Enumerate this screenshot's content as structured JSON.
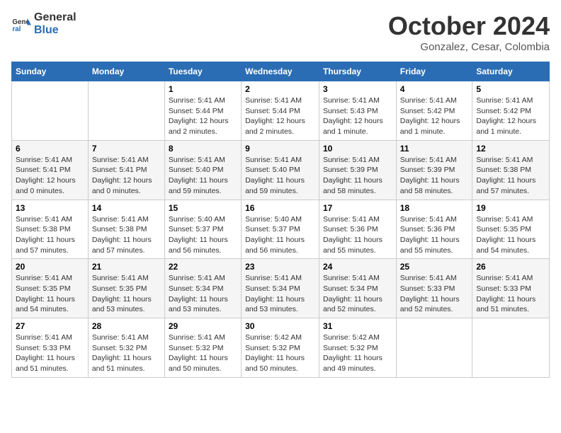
{
  "header": {
    "logo_general": "General",
    "logo_blue": "Blue",
    "month": "October 2024",
    "location": "Gonzalez, Cesar, Colombia"
  },
  "weekdays": [
    "Sunday",
    "Monday",
    "Tuesday",
    "Wednesday",
    "Thursday",
    "Friday",
    "Saturday"
  ],
  "weeks": [
    [
      {
        "day": "",
        "info": ""
      },
      {
        "day": "",
        "info": ""
      },
      {
        "day": "1",
        "info": "Sunrise: 5:41 AM\nSunset: 5:44 PM\nDaylight: 12 hours and 2 minutes."
      },
      {
        "day": "2",
        "info": "Sunrise: 5:41 AM\nSunset: 5:44 PM\nDaylight: 12 hours and 2 minutes."
      },
      {
        "day": "3",
        "info": "Sunrise: 5:41 AM\nSunset: 5:43 PM\nDaylight: 12 hours and 1 minute."
      },
      {
        "day": "4",
        "info": "Sunrise: 5:41 AM\nSunset: 5:42 PM\nDaylight: 12 hours and 1 minute."
      },
      {
        "day": "5",
        "info": "Sunrise: 5:41 AM\nSunset: 5:42 PM\nDaylight: 12 hours and 1 minute."
      }
    ],
    [
      {
        "day": "6",
        "info": "Sunrise: 5:41 AM\nSunset: 5:41 PM\nDaylight: 12 hours and 0 minutes."
      },
      {
        "day": "7",
        "info": "Sunrise: 5:41 AM\nSunset: 5:41 PM\nDaylight: 12 hours and 0 minutes."
      },
      {
        "day": "8",
        "info": "Sunrise: 5:41 AM\nSunset: 5:40 PM\nDaylight: 11 hours and 59 minutes."
      },
      {
        "day": "9",
        "info": "Sunrise: 5:41 AM\nSunset: 5:40 PM\nDaylight: 11 hours and 59 minutes."
      },
      {
        "day": "10",
        "info": "Sunrise: 5:41 AM\nSunset: 5:39 PM\nDaylight: 11 hours and 58 minutes."
      },
      {
        "day": "11",
        "info": "Sunrise: 5:41 AM\nSunset: 5:39 PM\nDaylight: 11 hours and 58 minutes."
      },
      {
        "day": "12",
        "info": "Sunrise: 5:41 AM\nSunset: 5:38 PM\nDaylight: 11 hours and 57 minutes."
      }
    ],
    [
      {
        "day": "13",
        "info": "Sunrise: 5:41 AM\nSunset: 5:38 PM\nDaylight: 11 hours and 57 minutes."
      },
      {
        "day": "14",
        "info": "Sunrise: 5:41 AM\nSunset: 5:38 PM\nDaylight: 11 hours and 57 minutes."
      },
      {
        "day": "15",
        "info": "Sunrise: 5:40 AM\nSunset: 5:37 PM\nDaylight: 11 hours and 56 minutes."
      },
      {
        "day": "16",
        "info": "Sunrise: 5:40 AM\nSunset: 5:37 PM\nDaylight: 11 hours and 56 minutes."
      },
      {
        "day": "17",
        "info": "Sunrise: 5:41 AM\nSunset: 5:36 PM\nDaylight: 11 hours and 55 minutes."
      },
      {
        "day": "18",
        "info": "Sunrise: 5:41 AM\nSunset: 5:36 PM\nDaylight: 11 hours and 55 minutes."
      },
      {
        "day": "19",
        "info": "Sunrise: 5:41 AM\nSunset: 5:35 PM\nDaylight: 11 hours and 54 minutes."
      }
    ],
    [
      {
        "day": "20",
        "info": "Sunrise: 5:41 AM\nSunset: 5:35 PM\nDaylight: 11 hours and 54 minutes."
      },
      {
        "day": "21",
        "info": "Sunrise: 5:41 AM\nSunset: 5:35 PM\nDaylight: 11 hours and 53 minutes."
      },
      {
        "day": "22",
        "info": "Sunrise: 5:41 AM\nSunset: 5:34 PM\nDaylight: 11 hours and 53 minutes."
      },
      {
        "day": "23",
        "info": "Sunrise: 5:41 AM\nSunset: 5:34 PM\nDaylight: 11 hours and 53 minutes."
      },
      {
        "day": "24",
        "info": "Sunrise: 5:41 AM\nSunset: 5:34 PM\nDaylight: 11 hours and 52 minutes."
      },
      {
        "day": "25",
        "info": "Sunrise: 5:41 AM\nSunset: 5:33 PM\nDaylight: 11 hours and 52 minutes."
      },
      {
        "day": "26",
        "info": "Sunrise: 5:41 AM\nSunset: 5:33 PM\nDaylight: 11 hours and 51 minutes."
      }
    ],
    [
      {
        "day": "27",
        "info": "Sunrise: 5:41 AM\nSunset: 5:33 PM\nDaylight: 11 hours and 51 minutes."
      },
      {
        "day": "28",
        "info": "Sunrise: 5:41 AM\nSunset: 5:32 PM\nDaylight: 11 hours and 51 minutes."
      },
      {
        "day": "29",
        "info": "Sunrise: 5:41 AM\nSunset: 5:32 PM\nDaylight: 11 hours and 50 minutes."
      },
      {
        "day": "30",
        "info": "Sunrise: 5:42 AM\nSunset: 5:32 PM\nDaylight: 11 hours and 50 minutes."
      },
      {
        "day": "31",
        "info": "Sunrise: 5:42 AM\nSunset: 5:32 PM\nDaylight: 11 hours and 49 minutes."
      },
      {
        "day": "",
        "info": ""
      },
      {
        "day": "",
        "info": ""
      }
    ]
  ]
}
